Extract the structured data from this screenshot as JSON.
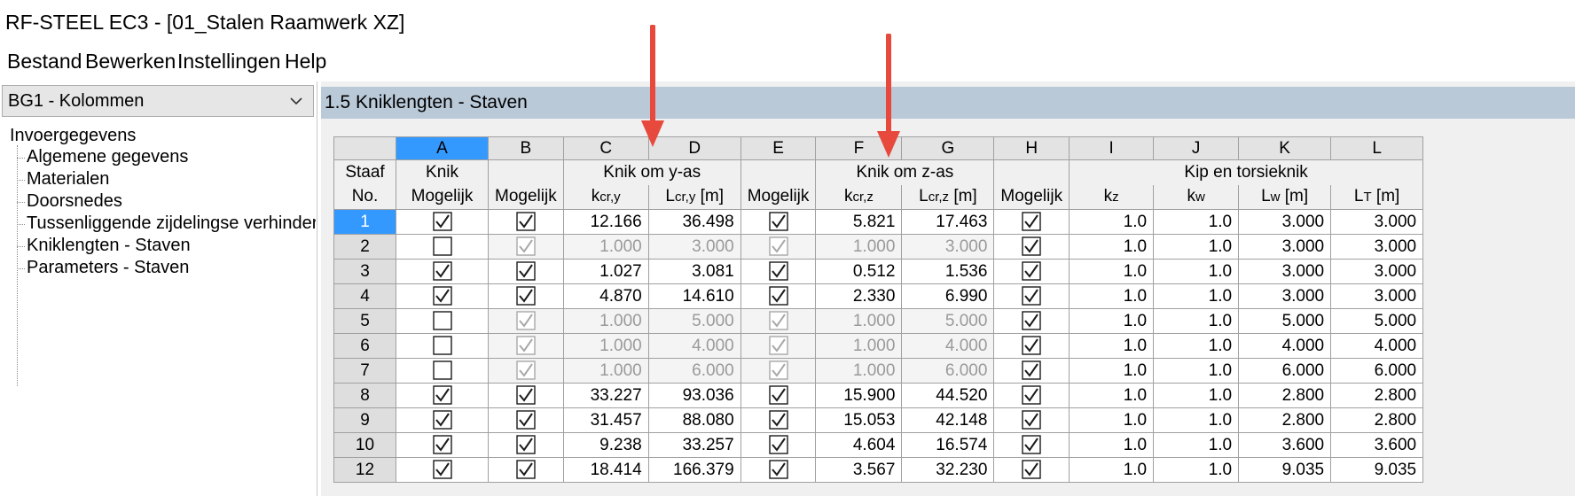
{
  "window": {
    "title": "RF-STEEL EC3 - [01_Stalen Raamwerk XZ]"
  },
  "menu": [
    "Bestand",
    "Bewerken",
    "Instellingen",
    "Help"
  ],
  "sidebar": {
    "combo_value": "BG1 - Kolommen",
    "root": "Invoergegevens",
    "items": [
      "Algemene gegevens",
      "Materialen",
      "Doorsnedes",
      "Tussenliggende zijdelingse verhinderingen",
      "Kniklengten - Staven",
      "Parameters - Staven"
    ],
    "selected_index": 4
  },
  "panel": {
    "title": "1.5 Kniklengten - Staven"
  },
  "table": {
    "column_letters": [
      "A",
      "B",
      "C",
      "D",
      "E",
      "F",
      "G",
      "H",
      "I",
      "J",
      "K",
      "L"
    ],
    "row_header_label_1": "Staaf",
    "row_header_label_2": "No.",
    "group_headers": {
      "A": "Knik",
      "CD": "Knik om y-as",
      "FG": "Knik om z-as",
      "IL": "Kip en torsieknik"
    },
    "sub_headers": {
      "A": "Mogelijk",
      "B": "Mogelijk",
      "C_main": "k",
      "C_sub": "cr,y",
      "D_main": "L",
      "D_sub": "cr,y",
      "D_unit": "[m]",
      "E": "Mogelijk",
      "F_main": "k",
      "F_sub": "cr,z",
      "G_main": "L",
      "G_sub": "cr,z",
      "G_unit": "[m]",
      "H": "Mogelijk",
      "I_main": "k",
      "I_sub": "z",
      "J_main": "k",
      "J_sub": "w",
      "K_main": "L",
      "K_sub": "w",
      "K_unit": "[m]",
      "L_main": "L",
      "L_sub": "T",
      "L_unit": "[m]"
    },
    "rows": [
      {
        "no": "1",
        "knik": true,
        "b": true,
        "kcry": "12.166",
        "lcry": "36.498",
        "e": true,
        "kcrz": "5.821",
        "lcrz": "17.463",
        "h": true,
        "kz": "1.0",
        "kw": "1.0",
        "lw": "3.000",
        "lt": "3.000"
      },
      {
        "no": "2",
        "knik": false,
        "b": true,
        "kcry": "1.000",
        "lcry": "3.000",
        "e": true,
        "kcrz": "1.000",
        "lcrz": "3.000",
        "h": true,
        "kz": "1.0",
        "kw": "1.0",
        "lw": "3.000",
        "lt": "3.000"
      },
      {
        "no": "3",
        "knik": true,
        "b": true,
        "kcry": "1.027",
        "lcry": "3.081",
        "e": true,
        "kcrz": "0.512",
        "lcrz": "1.536",
        "h": true,
        "kz": "1.0",
        "kw": "1.0",
        "lw": "3.000",
        "lt": "3.000"
      },
      {
        "no": "4",
        "knik": true,
        "b": true,
        "kcry": "4.870",
        "lcry": "14.610",
        "e": true,
        "kcrz": "2.330",
        "lcrz": "6.990",
        "h": true,
        "kz": "1.0",
        "kw": "1.0",
        "lw": "3.000",
        "lt": "3.000"
      },
      {
        "no": "5",
        "knik": false,
        "b": true,
        "kcry": "1.000",
        "lcry": "5.000",
        "e": true,
        "kcrz": "1.000",
        "lcrz": "5.000",
        "h": true,
        "kz": "1.0",
        "kw": "1.0",
        "lw": "5.000",
        "lt": "5.000"
      },
      {
        "no": "6",
        "knik": false,
        "b": true,
        "kcry": "1.000",
        "lcry": "4.000",
        "e": true,
        "kcrz": "1.000",
        "lcrz": "4.000",
        "h": true,
        "kz": "1.0",
        "kw": "1.0",
        "lw": "4.000",
        "lt": "4.000"
      },
      {
        "no": "7",
        "knik": false,
        "b": true,
        "kcry": "1.000",
        "lcry": "6.000",
        "e": true,
        "kcrz": "1.000",
        "lcrz": "6.000",
        "h": true,
        "kz": "1.0",
        "kw": "1.0",
        "lw": "6.000",
        "lt": "6.000"
      },
      {
        "no": "8",
        "knik": true,
        "b": true,
        "kcry": "33.227",
        "lcry": "93.036",
        "e": true,
        "kcrz": "15.900",
        "lcrz": "44.520",
        "h": true,
        "kz": "1.0",
        "kw": "1.0",
        "lw": "2.800",
        "lt": "2.800"
      },
      {
        "no": "9",
        "knik": true,
        "b": true,
        "kcry": "31.457",
        "lcry": "88.080",
        "e": true,
        "kcrz": "15.053",
        "lcrz": "42.148",
        "h": true,
        "kz": "1.0",
        "kw": "1.0",
        "lw": "2.800",
        "lt": "2.800"
      },
      {
        "no": "10",
        "knik": true,
        "b": true,
        "kcry": "9.238",
        "lcry": "33.257",
        "e": true,
        "kcrz": "4.604",
        "lcrz": "16.574",
        "h": true,
        "kz": "1.0",
        "kw": "1.0",
        "lw": "3.600",
        "lt": "3.600"
      },
      {
        "no": "12",
        "knik": true,
        "b": true,
        "kcry": "18.414",
        "lcry": "166.379",
        "e": true,
        "kcrz": "3.567",
        "lcrz": "32.230",
        "h": true,
        "kz": "1.0",
        "kw": "1.0",
        "lw": "9.035",
        "lt": "9.035"
      }
    ]
  },
  "colors": {
    "selection_blue": "#3399ff",
    "panel_header": "#b9c9d8",
    "annotation_arrow": "#e8493d"
  },
  "annotations": [
    "arrow-down-icon",
    "arrow-down-icon"
  ]
}
